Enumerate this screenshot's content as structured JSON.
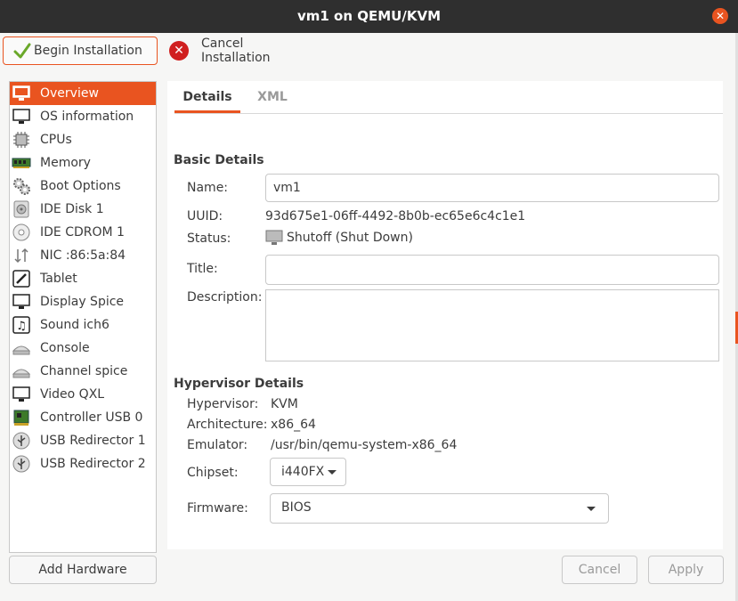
{
  "window": {
    "title": "vm1 on QEMU/KVM",
    "close_icon": "window-close-icon"
  },
  "toolbar": {
    "begin_label": "Begin Installation",
    "cancel_label": "Cancel Installation"
  },
  "sidebar": {
    "items": [
      {
        "label": "Overview",
        "icon": "monitor-icon",
        "active": true
      },
      {
        "label": "OS information",
        "icon": "monitor-icon"
      },
      {
        "label": "CPUs",
        "icon": "cpu-icon"
      },
      {
        "label": "Memory",
        "icon": "memory-icon"
      },
      {
        "label": "Boot Options",
        "icon": "gears-icon"
      },
      {
        "label": "IDE Disk 1",
        "icon": "disk-icon"
      },
      {
        "label": "IDE CDROM 1",
        "icon": "cdrom-icon"
      },
      {
        "label": "NIC :86:5a:84",
        "icon": "network-arrows-icon"
      },
      {
        "label": "Tablet",
        "icon": "tablet-icon"
      },
      {
        "label": "Display Spice",
        "icon": "monitor-icon"
      },
      {
        "label": "Sound ich6",
        "icon": "sound-icon"
      },
      {
        "label": "Console",
        "icon": "serial-icon"
      },
      {
        "label": "Channel spice",
        "icon": "serial-icon"
      },
      {
        "label": "Video QXL",
        "icon": "monitor-icon"
      },
      {
        "label": "Controller USB 0",
        "icon": "pci-card-icon"
      },
      {
        "label": "USB Redirector 1",
        "icon": "usb-icon"
      },
      {
        "label": "USB Redirector 2",
        "icon": "usb-icon"
      }
    ],
    "add_hardware_label": "Add Hardware"
  },
  "tabs": {
    "details": "Details",
    "xml": "XML"
  },
  "basic": {
    "heading": "Basic Details",
    "name_label": "Name:",
    "name_value": "vm1",
    "uuid_label": "UUID:",
    "uuid_value": "93d675e1-06ff-4492-8b0b-ec65e6c4c1e1",
    "status_label": "Status:",
    "status_value": "Shutoff (Shut Down)",
    "title_label": "Title:",
    "title_value": "",
    "description_label": "Description:",
    "description_value": ""
  },
  "hypervisor": {
    "heading": "Hypervisor Details",
    "hypervisor_label": "Hypervisor:",
    "hypervisor_value": "KVM",
    "architecture_label": "Architecture:",
    "architecture_value": "x86_64",
    "emulator_label": "Emulator:",
    "emulator_value": "/usr/bin/qemu-system-x86_64",
    "chipset_label": "Chipset:",
    "chipset_value": "i440FX",
    "firmware_label": "Firmware:",
    "firmware_value": "BIOS"
  },
  "footer": {
    "cancel_label": "Cancel",
    "apply_label": "Apply"
  },
  "colors": {
    "accent": "#e95420",
    "titlebar": "#2f2f2f",
    "cancel_red": "#d01f1f"
  }
}
